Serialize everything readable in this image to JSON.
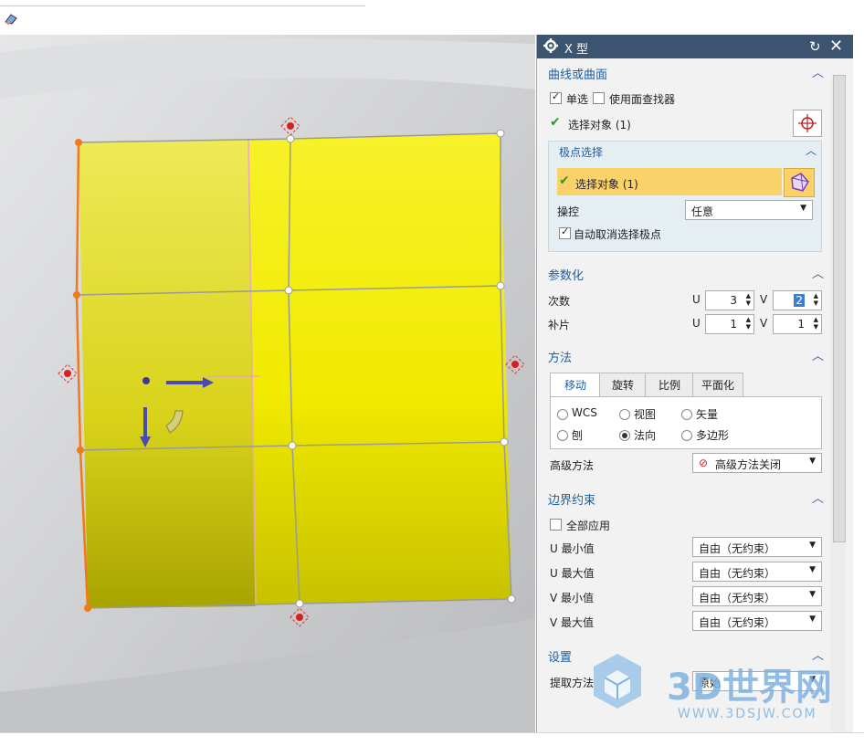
{
  "dialog": {
    "title": "X 型",
    "sections": {
      "curve": {
        "title": "曲线或曲面",
        "single_select": "单选",
        "use_face_finder": "使用面查找器",
        "select_object": "选择对象 (1)"
      },
      "pole": {
        "title": "极点选择",
        "select_object": "选择对象 (1)",
        "manipulate_label": "操控",
        "manipulate_value": "任意",
        "auto_deselect": "自动取消选择极点"
      },
      "param": {
        "title": "参数化",
        "degree_label": "次数",
        "patch_label": "补片",
        "u": "U",
        "v": "V",
        "degree_u": "3",
        "degree_v": "2",
        "patch_u": "1",
        "patch_v": "1"
      },
      "method": {
        "title": "方法",
        "tabs": [
          "移动",
          "旋转",
          "比例",
          "平面化"
        ],
        "radios": [
          "WCS",
          "视图",
          "矢量",
          "刨",
          "法向",
          "多边形"
        ],
        "advanced_label": "高级方法",
        "advanced_value": "高级方法关闭"
      },
      "boundary": {
        "title": "边界约束",
        "apply_all": "全部应用",
        "u_min": "U 最小值",
        "u_max": "U 最大值",
        "v_min": "V 最小值",
        "v_max": "V 最大值",
        "free": "自由（无约束）"
      },
      "settings": {
        "title": "设置",
        "extract_label": "提取方法",
        "extract_value": "原始"
      }
    }
  },
  "watermark": {
    "brand": "3D世界网",
    "url": "WWW.3DSJW.COM"
  },
  "colors": {
    "surface": "#f4ee00",
    "titlebar": "#3c5470",
    "highlight": "#fbd26a",
    "accent": "#1c5fa6"
  }
}
